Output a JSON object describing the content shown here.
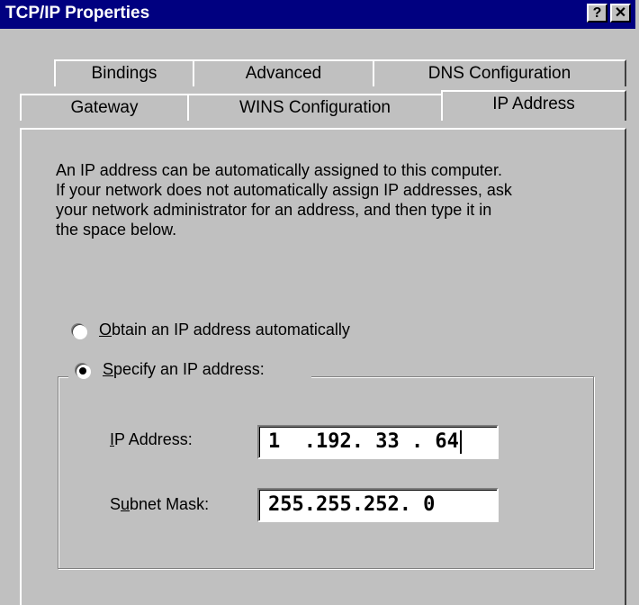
{
  "window": {
    "title": "TCP/IP Properties",
    "help_label": "?",
    "close_label": "✕"
  },
  "tabs": {
    "back": [
      {
        "label": "Bindings"
      },
      {
        "label": "Advanced"
      },
      {
        "label": "DNS Configuration"
      }
    ],
    "front": [
      {
        "label": "Gateway"
      },
      {
        "label": "WINS Configuration"
      },
      {
        "label": "IP Address",
        "active": true
      }
    ]
  },
  "description": [
    "An IP address can be automatically assigned to this computer.",
    "If your network does not automatically assign IP addresses, ask",
    "your network administrator for an address, and then type it in",
    "the space below."
  ],
  "options": {
    "auto": {
      "hotkey": "O",
      "rest": "btain an IP address automatically",
      "selected": false
    },
    "specify": {
      "hotkey": "S",
      "rest": "pecify an IP address:",
      "selected": true
    }
  },
  "fields": {
    "ip_address": {
      "hotkey": "I",
      "rest": "P Address:",
      "value": "1  .192. 33 . 64"
    },
    "subnet_mask": {
      "pre": "S",
      "hotkey": "u",
      "rest": "bnet Mask:",
      "value": "255.255.252. 0"
    }
  },
  "colors": {
    "titlebar": "#000080",
    "face": "#c0c0c0"
  }
}
